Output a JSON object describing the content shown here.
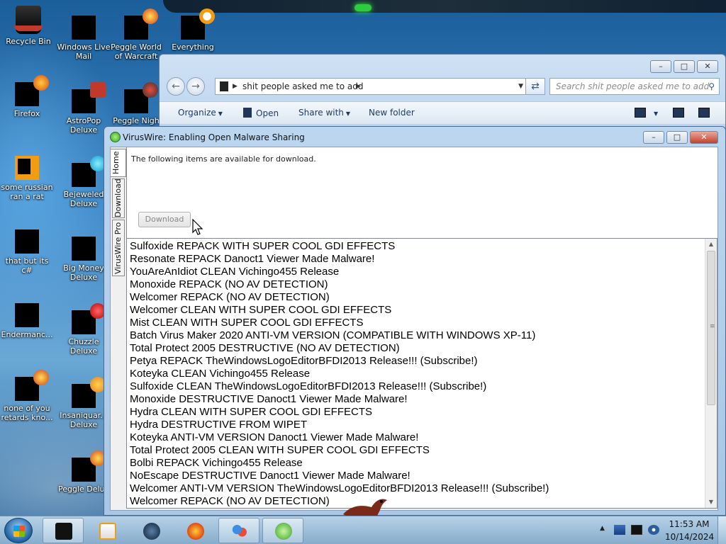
{
  "desktop": {
    "icons": [
      {
        "label": "Recycle Bin"
      },
      {
        "label": "Windows Live Mail"
      },
      {
        "label": "Peggle World of Warcraft"
      },
      {
        "label": "Everything"
      },
      {
        "label": "Firefox"
      },
      {
        "label": "AstroPop Deluxe"
      },
      {
        "label": "Peggle Nigh"
      },
      {
        "label": "some russian ran a rat"
      },
      {
        "label": "Bejeweled Deluxe"
      },
      {
        "label": "that but its c#"
      },
      {
        "label": "Big Money Deluxe"
      },
      {
        "label": "Endermanc..."
      },
      {
        "label": "Chuzzle Deluxe"
      },
      {
        "label": "none of you retards kno..."
      },
      {
        "label": "Insaniquar... Deluxe"
      },
      {
        "label": "Peggle Delux"
      }
    ]
  },
  "explorer": {
    "address_path": "shit people asked me to add",
    "search_placeholder": "Search shit people asked me to add",
    "commands": {
      "organize": "Organize",
      "open": "Open",
      "share_with": "Share with",
      "new_folder": "New folder"
    }
  },
  "viruswire": {
    "title": "VirusWire: Enabling Open Malware Sharing",
    "tabs": {
      "home": "Home",
      "download": "Download",
      "pro": "VirusWire Pro"
    },
    "message": "The following items are available for download.",
    "download_button": "Download",
    "items": [
      "Sulfoxide REPACK WITH SUPER COOL GDI EFFECTS",
      "Resonate REPACK Danoct1 Viewer Made Malware!",
      "YouAreAnIdiot CLEAN Vichingo455 Release",
      "Monoxide REPACK (NO AV DETECTION)",
      "Welcomer REPACK (NO AV DETECTION)",
      "Welcomer CLEAN WITH SUPER COOL GDI EFFECTS",
      "Mist CLEAN WITH SUPER COOL GDI EFFECTS",
      "Batch Virus Maker 2020 ANTI-VM VERSION (COMPATIBLE WITH WINDOWS XP-11)",
      "Total Protect 2005 DESTRUCTIVE (NO AV DETECTION)",
      "Petya REPACK TheWindowsLogoEditorBFDI2013 Release!!! (Subscribe!)",
      "Koteyka CLEAN Vichingo455 Release",
      "Sulfoxide CLEAN TheWindowsLogoEditorBFDI2013 Release!!! (Subscribe!)",
      "Monoxide DESTRUCTIVE Danoct1 Viewer Made Malware!",
      "Hydra CLEAN WITH SUPER COOL GDI EFFECTS",
      "Hydra DESTRUCTIVE FROM WIPET",
      "Koteyka ANTI-VM VERSION Danoct1 Viewer Made Malware!",
      "Total Protect 2005 CLEAN WITH SUPER COOL GDI EFFECTS",
      "Bolbi REPACK Vichingo455 Release",
      "NoEscape DESTRUCTIVE Danoct1 Viewer Made Malware!",
      "Welcomer ANTI-VM VERSION TheWindowsLogoEditorBFDI2013 Release!!! (Subscribe!)",
      "Welcomer REPACK (NO AV DETECTION)"
    ]
  },
  "taskbar": {
    "clock_time": "11:53 AM",
    "clock_date": "10/14/2024"
  }
}
